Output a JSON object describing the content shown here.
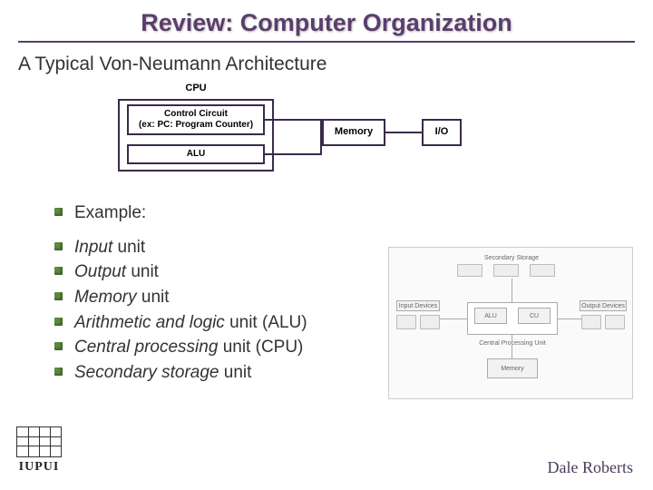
{
  "title": "Review: Computer Organization",
  "subtitle": "A Typical Von-Neumann Architecture",
  "diagram": {
    "cpu_label": "CPU",
    "control_line1": "Control Circuit",
    "control_line2": "(ex: PC: Program Counter)",
    "alu": "ALU",
    "memory": "Memory",
    "io": "I/O"
  },
  "bullets": {
    "example": "Example:",
    "b1_i": "Input",
    "b1_r": " unit",
    "b2_i": "Output",
    "b2_r": " unit",
    "b3_i": "Memory",
    "b3_r": " unit",
    "b4_i": "Arithmetic and logic",
    "b4_r": " unit (ALU)",
    "b5_i": "Central processing",
    "b5_r": " unit (CPU)",
    "b6_i": "Secondary storage",
    "b6_r": " unit"
  },
  "side_labels": {
    "sec": "Secondary Storage",
    "input": "Input Devices",
    "output": "Output Devices",
    "alu": "ALU",
    "cu": "CU",
    "cpu": "Central Processing Unit",
    "mem": "Memory"
  },
  "logo_text": "IUPUI",
  "footer": "Dale Roberts"
}
